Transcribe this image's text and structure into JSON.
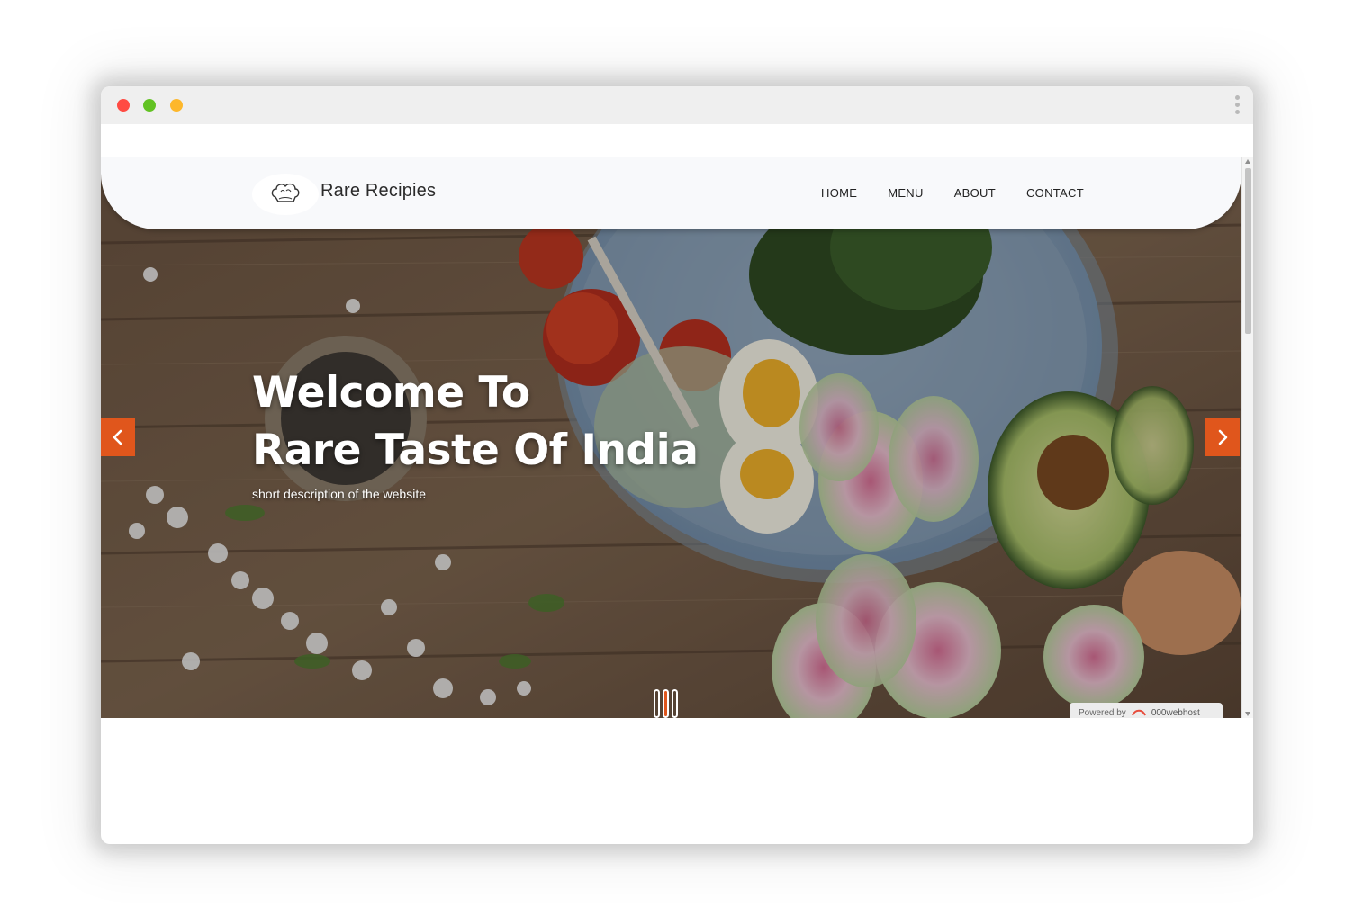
{
  "browser": {
    "window_controls": [
      "close",
      "minimize",
      "maximize"
    ],
    "menu_icon": "kebab-menu-icon"
  },
  "site": {
    "brand_name": "Rare Recipies",
    "logo_icon": "chef-hat-icon",
    "nav": [
      {
        "label": "HOME"
      },
      {
        "label": "MENU"
      },
      {
        "label": "ABOUT"
      },
      {
        "label": "CONTACT"
      }
    ]
  },
  "hero": {
    "title_line1": "Welcome To",
    "title_line2": "Rare Taste Of India",
    "subtitle": "short description of the website",
    "prev_icon": "chevron-left-icon",
    "next_icon": "chevron-right-icon",
    "slide_count": 3,
    "active_slide": 2
  },
  "footer_badge": {
    "prefix": "Powered by",
    "brand": "000webhost"
  },
  "colors": {
    "accent": "#e0561c",
    "navbar_bg": "#f8f9fb",
    "text_dark": "#222222"
  }
}
